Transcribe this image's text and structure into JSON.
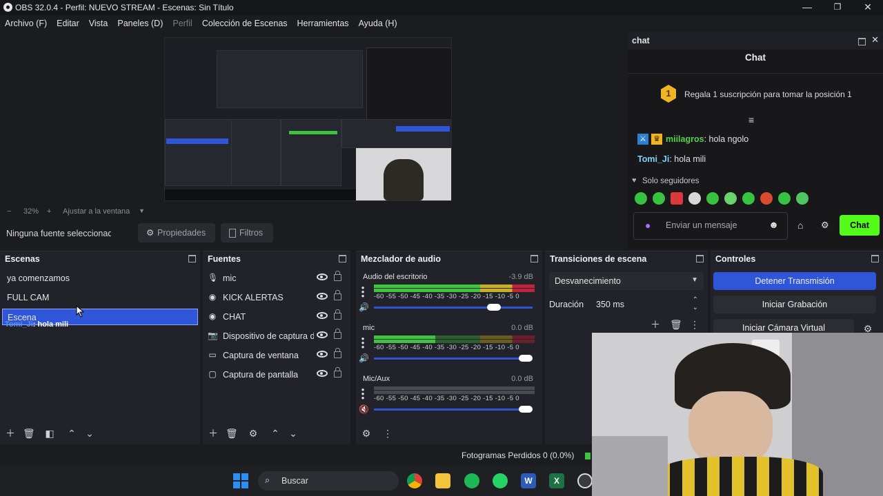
{
  "window": {
    "title": "OBS 32.0.4 - Perfil: NUEVO STREAM - Escenas: Sin Título",
    "minimize": "—",
    "maximize": "❐",
    "close": "✕"
  },
  "menu": [
    "Archivo (F)",
    "Editar",
    "Vista",
    "Paneles (D)",
    "Perfil",
    "Colección de Escenas",
    "Herramientas",
    "Ayuda (H)"
  ],
  "preview": {
    "zoom_minus": "−",
    "zoom": "32%",
    "zoom_plus": "+",
    "fit": "Ajustar a la ventana"
  },
  "source_toolbar": {
    "no_source": "Ninguna fuente seleccionada",
    "properties": "Propiedades",
    "filters": "Filtros"
  },
  "scenes": {
    "title": "Escenas",
    "items": [
      "ya comenzamos",
      "FULL CAM",
      "Escena"
    ],
    "selected": "Escena",
    "overlay_user": "Tomi_Ji",
    "overlay_text": ": hola mili"
  },
  "sources": {
    "title": "Fuentes",
    "items": [
      {
        "label": "mic",
        "icon": "microphone-icon"
      },
      {
        "label": "KICK ALERTAS",
        "icon": "globe-icon"
      },
      {
        "label": "CHAT",
        "icon": "globe-icon"
      },
      {
        "label": "Dispositivo de captura de video",
        "icon": "camera-icon"
      },
      {
        "label": "Captura de ventana",
        "icon": "window-icon"
      },
      {
        "label": "Captura de pantalla",
        "icon": "monitor-icon"
      }
    ]
  },
  "mixer": {
    "title": "Mezclador de audio",
    "scale": "-60 -55 -50 -45 -40 -35 -30 -25 -20 -15 -10 -5 0",
    "channels": [
      {
        "name": "Audio del escritorio",
        "db": "-3.9 dB",
        "level": 1.0,
        "volume": 0.8,
        "muted": false
      },
      {
        "name": "mic",
        "db": "0.0 dB",
        "level": 0.38,
        "volume": 1.0,
        "muted": false
      },
      {
        "name": "Mic/Aux",
        "db": "0.0 dB",
        "level": 0.0,
        "volume": 1.0,
        "muted": true
      }
    ]
  },
  "transitions": {
    "title": "Transiciones de escena",
    "selected": "Desvanecimiento",
    "duration_label": "Duración",
    "duration_value": "350 ms"
  },
  "controls": {
    "title": "Controles",
    "stop_stream": "Detener Transmisión",
    "start_record": "Iniciar Grabación",
    "start_vcam": "Iniciar Cámara Virtual"
  },
  "chat": {
    "dock_title": "chat",
    "header": "Chat",
    "gift_rank": "1",
    "gift_text": "Regala 1 suscripción para tomar la posición 1",
    "messages": [
      {
        "user": "miilagros",
        "text": ": hola ngolo",
        "color": "#56d24d"
      },
      {
        "user": "Tomi_Ji",
        "text": ": hola mili",
        "color": "#7dd3fc"
      }
    ],
    "followers_only": "Solo seguidores",
    "input_placeholder": "Enviar un mensaje",
    "send": "Chat"
  },
  "status": {
    "dropped_frames": "Fotogramas Perdidos 0 (0.0%)"
  },
  "taskbar": {
    "search": "Buscar"
  },
  "colors": {
    "accent": "#2f56d8",
    "chat_green": "#53fc18",
    "meter_green": "#3fc43f",
    "meter_yellow": "#c9b021",
    "meter_red": "#c3243c"
  }
}
